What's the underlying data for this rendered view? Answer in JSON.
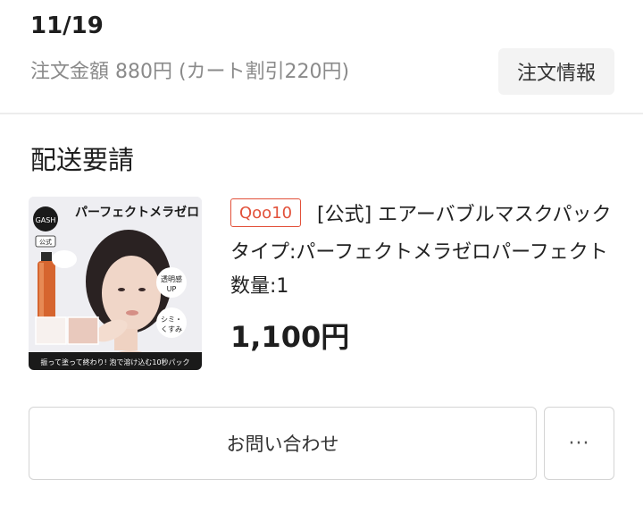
{
  "order": {
    "date": "11/19",
    "amount_text": "注文金額 880円 (カート割引220円)",
    "info_button_label": "注文情報"
  },
  "shipment": {
    "status": "配送要請"
  },
  "item": {
    "store_badge": "Qoo10",
    "title": "[公式] エアーバブルマスクパック",
    "option": "タイプ:パーフェクトメラゼロパーフェクト",
    "quantity": "数量:1",
    "price": "1,100円",
    "image": {
      "brand": "GASH",
      "official": "公式",
      "headline": "パーフェクトメラゼロ",
      "badge_top": "透明感",
      "badge_top_sub": "UP",
      "badge_bottom": "シミ・",
      "badge_bottom_sub": "くすみ",
      "caption": "振って塗って終わり! 泡で溶け込む10秒パック"
    }
  },
  "actions": {
    "contact_label": "お問い合わせ",
    "more_label": "···"
  },
  "colors": {
    "accent_red": "#e2513a",
    "border": "#d4d4d4",
    "muted_text": "#8a8a8a"
  }
}
